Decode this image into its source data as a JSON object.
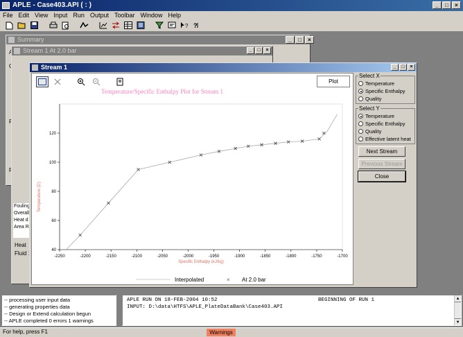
{
  "app": {
    "title": "APLE - Case403.API  ( : )"
  },
  "menu": [
    "File",
    "Edit",
    "View",
    "Input",
    "Run",
    "Output",
    "Toolbar",
    "Window",
    "Help"
  ],
  "bg_windows": {
    "summary_title": "Summary",
    "stream_at_title": "Stream 1 At 2.0 bar",
    "left_labels": [
      "A",
      "G",
      "F",
      "F"
    ],
    "list_labels": [
      "Fouling",
      "Overall",
      "Heat d",
      "Area R"
    ],
    "heat_label": "Heat",
    "fluid_label": "Fluid 1"
  },
  "stream_window": {
    "title": "Stream 1",
    "plot_button": "Plot",
    "select_x": {
      "label": "Select X",
      "options": [
        "Temperature",
        "Specific Enthalpy",
        "Quality"
      ],
      "selected": 1
    },
    "select_y": {
      "label": "Select Y",
      "options": [
        "Temperature",
        "Specific Enthalpy",
        "Quality",
        "Effective latent heat"
      ],
      "selected": 0
    },
    "buttons": {
      "next": "Next Stream",
      "previous": "Previous Stream",
      "close": "Close"
    }
  },
  "chart_data": {
    "type": "line",
    "title": "Temperature/Specific Enthalpy Plot for Stream 1",
    "xlabel": "Specific Enthalpy (kJ/kg)",
    "ylabel": "Temperature (C)",
    "xlim": [
      -2250,
      -1700
    ],
    "ylim": [
      40,
      140
    ],
    "xticks": [
      -2250,
      -2200,
      -2150,
      -2100,
      -2050,
      -2000,
      -1950,
      -1900,
      -1850,
      -1800,
      -1750,
      -1700
    ],
    "yticks": [
      40,
      60,
      80,
      100,
      120
    ],
    "series": [
      {
        "name": "Interpolated",
        "style": "line",
        "x": [
          -2237,
          -2210,
          -2155,
          -2097,
          -2036,
          -1975,
          -1940,
          -1908,
          -1883,
          -1857,
          -1830,
          -1805,
          -1778,
          -1745,
          -1730,
          -1710
        ],
        "y": [
          40,
          50,
          72,
          95,
          100,
          105,
          107.5,
          109.5,
          111,
          112,
          113,
          114,
          114.5,
          116,
          121,
          133
        ]
      },
      {
        "name": "At 2.0 bar",
        "style": "marker",
        "x": [
          -2210,
          -2155,
          -2097,
          -2036,
          -1975,
          -1940,
          -1908,
          -1883,
          -1857,
          -1830,
          -1805,
          -1778,
          -1745,
          -1736
        ],
        "y": [
          50,
          72,
          95,
          100,
          105,
          107.5,
          109.5,
          111,
          112,
          113,
          114,
          114.5,
          116,
          120
        ]
      }
    ]
  },
  "log": {
    "lines": [
      "-- processing user input data",
      "-- generating properties data",
      "-- Design or Extend calculation begun",
      "-- APLE completed  0 errors  1 warnings"
    ],
    "run_line1": "APLE RUN ON 18-FEB-2004 10:52",
    "run_begin": "BEGINNING OF RUN  1",
    "run_line2": "INPUT: D:\\data\\HTFS\\APLE_PlateDataBank\\Case403.API"
  },
  "status": {
    "help": "For help, press F1",
    "warnings": "Warnings",
    "warnings_color": "#f08060"
  }
}
